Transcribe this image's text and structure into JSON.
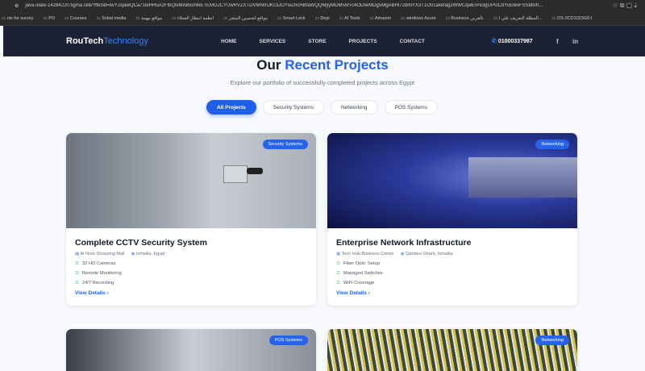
{
  "browser": {
    "url": "java-slate-14284220.figma.site/?fbclid=IwY2xjawQCa71leHRuA2FlbQIxMABicmlkETEMGJCYUwRVZXTDVMNmJKc3JOYwZhcHBfaWQQMjlyMDM5MTc4ODIwMDg5MgABHl72diNYX3T1O01axkfag2WWCqwEIPe3gUPGC8YuElevFSSldtvfI...",
    "bookmarks": [
      "ols for survey",
      "PO",
      "Courses",
      "Sotial media",
      "مواقع مهمة",
      "انظمة انتظار العملاء",
      "مواقع لتحسين المتجر",
      "Smart Lock",
      "Depi",
      "AI Tools",
      "Amazon",
      "windows Azure",
      "Business بالعربي",
      "المظلة التعريف على ا...",
      "DS-2CD1023G0-I"
    ]
  },
  "nav": {
    "logo_a": "RouTech",
    "logo_b": "Technology",
    "links": [
      "HOME",
      "SERVICES",
      "STORE",
      "PROJECTS",
      "CONTACT"
    ],
    "phone": "01000337987",
    "social": [
      "f",
      "in"
    ]
  },
  "hero": {
    "title_a": "Our",
    "title_b": "Recent Projects",
    "subtitle": "Explore our portfolio of successfully completed projects across Egypt"
  },
  "filters": [
    "All Projects",
    "Security Systems",
    "Networking",
    "POS Systems"
  ],
  "projects": [
    {
      "badge": "Security Systems",
      "title": "Complete CCTV Security System",
      "client": "Al-Noor Shopping Mall",
      "location": "Ismailia, Egypt",
      "features": [
        "32 HD Cameras",
        "Remote Monitoring",
        "24/7 Recording"
      ],
      "cta": "View Details"
    },
    {
      "badge": "Networking",
      "title": "Enterprise Network Infrastructure",
      "client": "Tech Hub Business Center",
      "location": "Qantara Gharb, Ismailia",
      "features": [
        "Fiber Optic Setup",
        "Managed Switches",
        "WiFi Coverage"
      ],
      "cta": "View Details"
    },
    {
      "badge": "POS Systems"
    },
    {
      "badge": "Networking"
    }
  ]
}
